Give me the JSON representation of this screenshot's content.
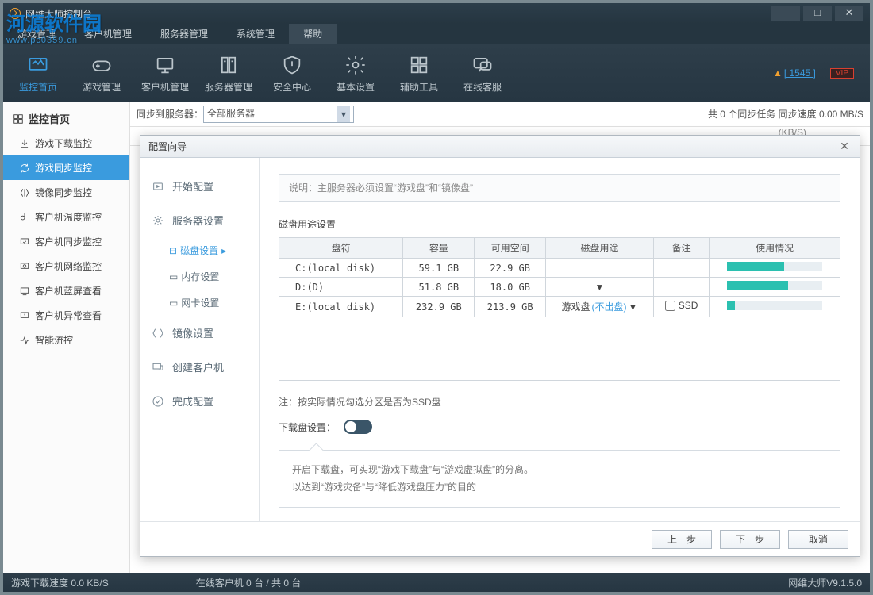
{
  "watermark": {
    "main": "河源软件园",
    "sub": "www.pc0359.cn"
  },
  "title": "网维大师控制台",
  "menu": [
    "游戏管理",
    "客户机管理",
    "服务器管理",
    "系统管理",
    "帮助"
  ],
  "menu_active": 4,
  "toolbar": [
    {
      "label": "监控首页",
      "icon": "monitor"
    },
    {
      "label": "游戏管理",
      "icon": "gamepad"
    },
    {
      "label": "客户机管理",
      "icon": "pc"
    },
    {
      "label": "服务器管理",
      "icon": "server"
    },
    {
      "label": "安全中心",
      "icon": "shield"
    },
    {
      "label": "基本设置",
      "icon": "gear"
    },
    {
      "label": "辅助工具",
      "icon": "tools"
    },
    {
      "label": "在线客服",
      "icon": "chat"
    }
  ],
  "toolbar_right": {
    "warn": "▲",
    "count_link": "[ 1545 ]",
    "close": "]",
    "vip": "VIP"
  },
  "sidebar": {
    "header": "监控首页",
    "items": [
      {
        "label": "游戏下载监控",
        "icon": "download"
      },
      {
        "label": "游戏同步监控",
        "icon": "sync"
      },
      {
        "label": "镜像同步监控",
        "icon": "mirror"
      },
      {
        "label": "客户机温度监控",
        "icon": "temp"
      },
      {
        "label": "客户机同步监控",
        "icon": "sync2"
      },
      {
        "label": "客户机网络监控",
        "icon": "net"
      },
      {
        "label": "客户机蓝屏查看",
        "icon": "screen"
      },
      {
        "label": "客户机异常查看",
        "icon": "err"
      },
      {
        "label": "智能流控",
        "icon": "flow"
      }
    ],
    "active": 1
  },
  "syncbar": {
    "label": "同步到服务器：",
    "select": "全部服务器",
    "right": "共 0 个同步任务    同步速度 0.00 MB/S"
  },
  "tabbar_right": "(KB/S)",
  "dialog": {
    "title": "配置向导",
    "side": [
      {
        "label": "开始配置",
        "icon": "start"
      },
      {
        "label": "服务器设置",
        "icon": "gear",
        "subs": [
          {
            "label": "磁盘设置",
            "arrow": "▸",
            "active": true
          },
          {
            "label": "内存设置"
          },
          {
            "label": "网卡设置"
          }
        ]
      },
      {
        "label": "镜像设置",
        "icon": "mirror"
      },
      {
        "label": "创建客户机",
        "icon": "client"
      },
      {
        "label": "完成配置",
        "icon": "done"
      }
    ],
    "info": "说明：主服务器必须设置“游戏盘”和“镜像盘”",
    "disk_title": "磁盘用途设置",
    "headers": [
      "盘符",
      "容量",
      "可用空间",
      "磁盘用途",
      "备注",
      "使用情况"
    ],
    "rows": [
      {
        "drive": "C:(local disk)",
        "cap": "59.1 GB",
        "free": "22.9 GB",
        "use": "",
        "note": "",
        "pct": 60
      },
      {
        "drive": "D:(D)",
        "cap": "51.8 GB",
        "free": "18.0 GB",
        "use": "▼",
        "note": "",
        "pct": 64
      },
      {
        "drive": "E:(local disk)",
        "cap": "232.9 GB",
        "free": "213.9 GB",
        "use_label": "游戏盘",
        "use_link": "(不出盘)",
        "use": "▼",
        "ssd": "SSD",
        "pct": 8
      }
    ],
    "note": "注：按实际情况勾选分区是否为SSD盘",
    "dl_label": "下载盘设置：",
    "tip1": "开启下载盘，可实现“游戏下载盘”与“游戏虚拟盘”的分离。",
    "tip2": "以达到“游戏灾备”与“降低游戏盘压力”的目的",
    "buttons": [
      "上一步",
      "下一步",
      "取消"
    ]
  },
  "status": {
    "dl": "游戏下载速度 0.0 KB/S",
    "clients": "在线客户机 0 台 / 共 0 台",
    "ver": "网维大师V9.1.5.0"
  }
}
